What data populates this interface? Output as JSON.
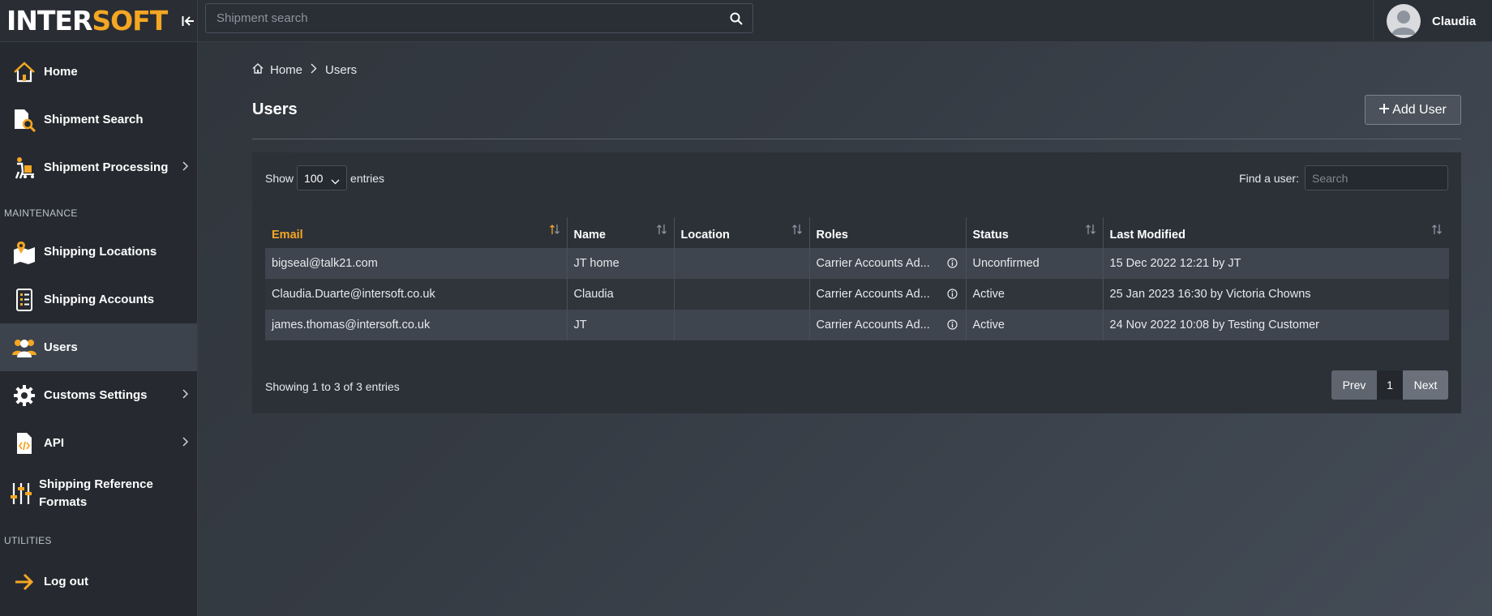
{
  "brand": {
    "logo_part1": "INTER",
    "logo_part2": "SOFT",
    "accent": "#f5a623"
  },
  "topbar": {
    "search_placeholder": "Shipment search",
    "user_name": "Claudia"
  },
  "sidebar": {
    "items": [
      {
        "label": "Home",
        "icon": "home-icon"
      },
      {
        "label": "Shipment Search",
        "icon": "document-search-icon"
      },
      {
        "label": "Shipment Processing",
        "icon": "worker-trolley-icon"
      },
      {
        "label": "Shipping Locations",
        "icon": "map-pin-icon"
      },
      {
        "label": "Shipping Accounts",
        "icon": "list-icon"
      },
      {
        "label": "Users",
        "icon": "users-icon"
      },
      {
        "label": "Customs Settings",
        "icon": "gear-icon"
      },
      {
        "label": "API",
        "icon": "code-file-icon"
      },
      {
        "label": "Shipping Reference Formats",
        "icon": "sliders-icon"
      },
      {
        "label": "Log out",
        "icon": "arrow-right-icon"
      }
    ],
    "section_maintenance": "MAINTENANCE",
    "section_utilities": "UTILITIES"
  },
  "breadcrumb": {
    "home": "Home",
    "current": "Users"
  },
  "page": {
    "title": "Users",
    "add_user_label": "Add User"
  },
  "table_controls": {
    "show_label": "Show",
    "entries_label": "entries",
    "page_length": "100",
    "find_label": "Find a user:",
    "find_placeholder": "Search"
  },
  "table": {
    "columns": [
      "Email",
      "Name",
      "Location",
      "Roles",
      "Status",
      "Last Modified"
    ],
    "rows": [
      {
        "email": "bigseal@talk21.com",
        "name": "JT home",
        "location": "",
        "roles": "Carrier Accounts Ad...",
        "status": "Unconfirmed",
        "modified": "15 Dec 2022 12:21 by JT"
      },
      {
        "email": "Claudia.Duarte@intersoft.co.uk",
        "name": "Claudia",
        "location": "",
        "roles": "Carrier Accounts Ad...",
        "status": "Active",
        "modified": "25 Jan 2023 16:30 by Victoria Chowns"
      },
      {
        "email": "james.thomas@intersoft.co.uk",
        "name": "JT",
        "location": "",
        "roles": "Carrier Accounts Ad...",
        "status": "Active",
        "modified": "24 Nov 2022 10:08 by Testing Customer"
      }
    ]
  },
  "footer": {
    "showing": "Showing 1 to 3 of 3 entries",
    "prev": "Prev",
    "page": "1",
    "next": "Next"
  }
}
